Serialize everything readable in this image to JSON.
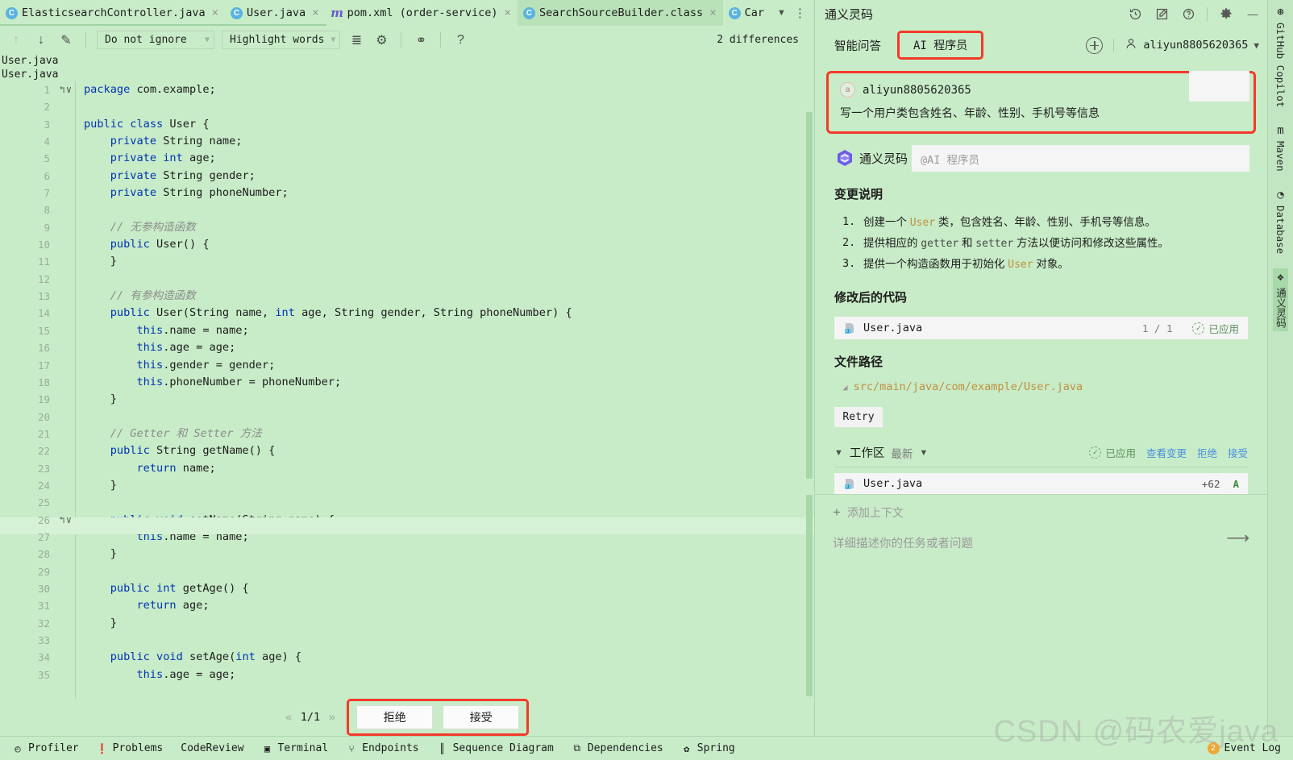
{
  "editor": {
    "tabs": [
      {
        "label": "ElasticsearchController.java",
        "icon": "java-class-icon",
        "active": false,
        "closable": true
      },
      {
        "label": "User.java",
        "icon": "java-modified-icon",
        "active": false,
        "closable": true
      },
      {
        "label": "pom.xml (order-service)",
        "icon": "maven-icon",
        "active": false,
        "closable": true
      },
      {
        "label": "SearchSourceBuilder.class",
        "icon": "java-class-icon",
        "active": true,
        "closable": true
      },
      {
        "label": "Car",
        "icon": "java-class-icon",
        "active": false,
        "closable": false
      }
    ],
    "tab_overflow_icon": "chevron-down-icon",
    "tab_more_icon": "more-vertical-icon",
    "toolbar": {
      "prev_diff_icon": "arrow-up-icon",
      "next_diff_icon": "arrow-down-icon",
      "edit_icon": "pencil-icon",
      "ignore_select": "Do not ignore",
      "highlight_select": "Highlight words",
      "collapse_icon": "collapse-unchanged-icon",
      "settings_icon": "gear-icon",
      "sync_icon": "sync-scroll-icon",
      "help_icon": "help-icon",
      "differences": "2 differences"
    },
    "left_file_title": "User.java",
    "right_file_title": "User.java",
    "pager": {
      "prev": "«",
      "label": "1/1",
      "next": "»",
      "reject": "拒绝",
      "accept": "接受"
    },
    "code_lines": [
      {
        "n": 1,
        "icons": "↰∨",
        "html": "<span class='k'>package</span> com.example;"
      },
      {
        "n": 2,
        "icons": "",
        "html": ""
      },
      {
        "n": 3,
        "icons": "",
        "html": "<span class='k'>public class</span> User {"
      },
      {
        "n": 4,
        "icons": "",
        "html": "    <span class='k'>private</span> String name;"
      },
      {
        "n": 5,
        "icons": "",
        "html": "    <span class='k'>private</span> <span class='k'>int</span> age;"
      },
      {
        "n": 6,
        "icons": "",
        "html": "    <span class='k'>private</span> String gender;"
      },
      {
        "n": 7,
        "icons": "",
        "html": "    <span class='k'>private</span> String phoneNumber;"
      },
      {
        "n": 8,
        "icons": "",
        "html": ""
      },
      {
        "n": 9,
        "icons": "",
        "html": "    <span class='cm'>// 无参构造函数</span>"
      },
      {
        "n": 10,
        "icons": "",
        "html": "    <span class='k'>public</span> User() {"
      },
      {
        "n": 11,
        "icons": "",
        "html": "    }"
      },
      {
        "n": 12,
        "icons": "",
        "html": ""
      },
      {
        "n": 13,
        "icons": "",
        "html": "    <span class='cm'>// 有参构造函数</span>"
      },
      {
        "n": 14,
        "icons": "",
        "html": "    <span class='k'>public</span> User(String name, <span class='k'>int</span> age, String gender, String phoneNumber) {"
      },
      {
        "n": 15,
        "icons": "",
        "html": "        <span class='k'>this</span>.name = name;"
      },
      {
        "n": 16,
        "icons": "",
        "html": "        <span class='k'>this</span>.age = age;"
      },
      {
        "n": 17,
        "icons": "",
        "html": "        <span class='k'>this</span>.gender = gender;"
      },
      {
        "n": 18,
        "icons": "",
        "html": "        <span class='k'>this</span>.phoneNumber = phoneNumber;"
      },
      {
        "n": 19,
        "icons": "",
        "html": "    }"
      },
      {
        "n": 20,
        "icons": "",
        "html": ""
      },
      {
        "n": 21,
        "icons": "",
        "html": "    <span class='cm'>// Getter 和 Setter 方法</span>"
      },
      {
        "n": 22,
        "icons": "",
        "html": "    <span class='k'>public</span> String getName() {"
      },
      {
        "n": 23,
        "icons": "",
        "html": "        <span class='k'>return</span> name;"
      },
      {
        "n": 24,
        "icons": "",
        "html": "    }"
      },
      {
        "n": 25,
        "icons": "",
        "html": ""
      },
      {
        "n": 26,
        "icons": "↰∨",
        "html": "    <span class='k'>public void</span> setName(String name) {"
      },
      {
        "n": 27,
        "icons": "",
        "html": "        <span class='k'>this</span>.name = name;"
      },
      {
        "n": 28,
        "icons": "",
        "html": "    }"
      },
      {
        "n": 29,
        "icons": "",
        "html": ""
      },
      {
        "n": 30,
        "icons": "",
        "html": "    <span class='k'>public int</span> getAge() {"
      },
      {
        "n": 31,
        "icons": "",
        "html": "        <span class='k'>return</span> age;"
      },
      {
        "n": 32,
        "icons": "",
        "html": "    }"
      },
      {
        "n": 33,
        "icons": "",
        "html": ""
      },
      {
        "n": 34,
        "icons": "",
        "html": "    <span class='k'>public void</span> setAge(<span class='k'>int</span> age) {"
      },
      {
        "n": 35,
        "icons": "",
        "html": "        <span class='k'>this</span>.age = age;"
      }
    ]
  },
  "tool_panel": {
    "title": "通义灵码",
    "header_icons": [
      "history-icon",
      "new-chat-icon",
      "help-icon",
      "gear-icon",
      "minimize-icon"
    ],
    "tabs": [
      {
        "label": "智能问答",
        "highlighted": false
      },
      {
        "label": "AI 程序员",
        "highlighted": true
      }
    ],
    "add_icon": "plus-circle-icon",
    "user": {
      "name": "aliyun8805620365",
      "avatar_icon": "user-icon",
      "chevron": "chevron-down-icon"
    },
    "user_message": {
      "avatar_letter": "a",
      "name": "aliyun8805620365",
      "text": "写一个用户类包含姓名、年龄、性别、手机号等信息",
      "highlighted": true
    },
    "assistant": {
      "logo_icon": "tongyi-lingma-logo",
      "name": "通义灵码",
      "mention": "@AI 程序员"
    },
    "change_summary": {
      "heading": "变更说明",
      "items": [
        {
          "num": "1.",
          "parts": [
            {
              "t": "创建一个 ",
              "style": "text"
            },
            {
              "t": "User",
              "style": "ident"
            },
            {
              "t": " 类，包含姓名、年龄、性别、手机号等信息。",
              "style": "text"
            }
          ]
        },
        {
          "num": "2.",
          "parts": [
            {
              "t": "提供相应的 ",
              "style": "text"
            },
            {
              "t": "getter",
              "style": "code"
            },
            {
              "t": " 和 ",
              "style": "text"
            },
            {
              "t": "setter",
              "style": "code"
            },
            {
              "t": " 方法以便访问和修改这些属性。",
              "style": "text"
            }
          ]
        },
        {
          "num": "3.",
          "parts": [
            {
              "t": "提供一个构造函数用于初始化 ",
              "style": "text"
            },
            {
              "t": "User",
              "style": "ident"
            },
            {
              "t": " 对象。",
              "style": "text"
            }
          ]
        }
      ]
    },
    "modified_code": {
      "heading": "修改后的代码",
      "file": {
        "icon": "java-file-icon",
        "name": "User.java",
        "count": "1 / 1",
        "status": "已应用",
        "status_icon": "applied-check-icon"
      }
    },
    "file_path": {
      "heading": "文件路径",
      "pin_icon": "pin-icon",
      "path": "src/main/java/com/example/User.java"
    },
    "retry_label": "Retry",
    "workspace": {
      "chevron_icon": "chevron-down-icon",
      "label": "工作区",
      "sub": "最新",
      "sub_chevron_icon": "chevron-down-icon",
      "status_icon": "applied-check-icon",
      "status": "已应用",
      "actions": [
        "查看变更",
        "拒绝",
        "接受"
      ],
      "file": {
        "icon": "java-file-icon",
        "name": "User.java",
        "added": "+62",
        "flag": "A"
      }
    },
    "composer": {
      "add_context": "添加上下文",
      "add_icon": "plus-icon",
      "placeholder": "详细描述你的任务或者问题",
      "send_icon": "arrow-right-icon"
    }
  },
  "right_strip": {
    "items": [
      {
        "label": "GitHub Copilot",
        "icon": "copilot-icon",
        "selected": false
      },
      {
        "label": "Maven",
        "icon": "maven-icon",
        "selected": false
      },
      {
        "label": "Database",
        "icon": "database-icon",
        "selected": false
      },
      {
        "label": "通义灵码",
        "icon": "tongyi-lingma-logo",
        "selected": true
      }
    ]
  },
  "status_bar": {
    "items": [
      {
        "label": "Profiler",
        "icon": "profiler-icon"
      },
      {
        "label": "Problems",
        "icon": "problems-icon"
      },
      {
        "label": "CodeReview",
        "icon": ""
      },
      {
        "label": "Terminal",
        "icon": "terminal-icon"
      },
      {
        "label": "Endpoints",
        "icon": "endpoints-icon"
      },
      {
        "label": "Sequence Diagram",
        "icon": "sequence-diagram-icon"
      },
      {
        "label": "Dependencies",
        "icon": "dependencies-icon"
      },
      {
        "label": "Spring",
        "icon": "spring-icon"
      }
    ],
    "event_log": {
      "label": "Event Log",
      "badge": "2"
    }
  },
  "watermark": "CSDN @码农爱java"
}
